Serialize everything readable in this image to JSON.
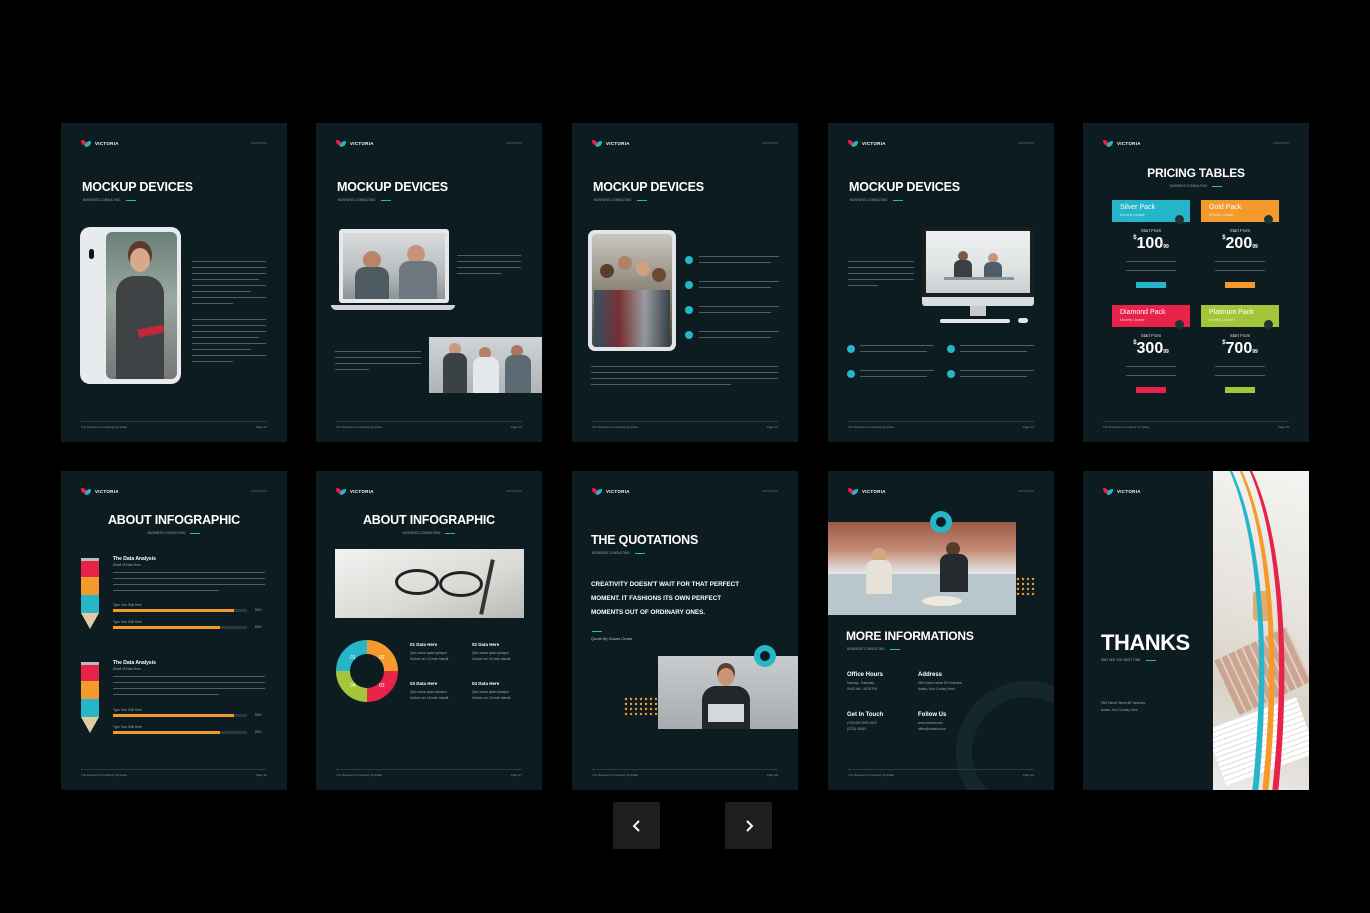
{
  "brand": "VICTORIA",
  "subtitle": "BUSINESS CONSULTING",
  "footer_left": "The Business Consulting Template",
  "accent_colors": {
    "teal": "#25b7c9",
    "pink": "#e8234a",
    "orange": "#f49a2c",
    "lime": "#a4c43a",
    "bg": "#0d1c20"
  },
  "slides": {
    "s1": {
      "title": "MOCKUP DEVICES",
      "page": "Page 21"
    },
    "s2": {
      "title": "MOCKUP DEVICES",
      "page": "Page 22"
    },
    "s3": {
      "title": "MOCKUP DEVICES",
      "page": "Page 23"
    },
    "s4": {
      "title": "MOCKUP DEVICES",
      "page": "Page 24"
    },
    "s5": {
      "title": "PRICING TABLES",
      "page": "Page 25",
      "start_from": "Start From",
      "packs": [
        {
          "name": "Silver Pack",
          "sub": "Monthly Update",
          "currency": "$",
          "price": "100",
          "cents": "99"
        },
        {
          "name": "Gold Pack",
          "sub": "Monthly Update",
          "currency": "$",
          "price": "200",
          "cents": "99"
        },
        {
          "name": "Diamond Pack",
          "sub": "Monthly Update",
          "currency": "$",
          "price": "300",
          "cents": "99"
        },
        {
          "name": "Platinum Pack",
          "sub": "Monthly Update",
          "currency": "$",
          "price": "700",
          "cents": "99"
        }
      ]
    },
    "s6": {
      "title": "ABOUT INFOGRAPHIC",
      "page": "Page 26",
      "heading1": "The Data Analysis",
      "heading2": "The Data Analysis",
      "detail": "Detail Of Data Here",
      "skill_label": "Type Your Skill Here",
      "skills": [
        {
          "pct": "90%",
          "value": 0.9
        },
        {
          "pct": "80%",
          "value": 0.8
        },
        {
          "pct": "90%",
          "value": 0.9
        },
        {
          "pct": "80%",
          "value": 0.8
        }
      ]
    },
    "s7": {
      "title": "ABOUT INFOGRAPHIC",
      "page": "Page 27",
      "items": [
        {
          "label": "01 Data Here",
          "text": "Quis varius quam quisque",
          "text2": "Id diam vel. Ut enim blandit"
        },
        {
          "label": "02 Data Here",
          "text": "Quis varius quam quisque",
          "text2": "Id diam vel. Ut enim blandit"
        },
        {
          "label": "03 Data Here",
          "text": "Quis varius quam quisque",
          "text2": "Id diam vel. Ut enim blandit"
        },
        {
          "label": "04 Data Here",
          "text": "Quis varius quam quisque",
          "text2": "Id diam vel. Ut enim blandit"
        }
      ],
      "ring_labels": [
        "01",
        "02",
        "03",
        "04"
      ]
    },
    "s8": {
      "title": "THE QUOTATIONS",
      "page": "Page 28",
      "quote_l1": "CREATIVITY DOESN'T WAIT FOR THAT PERFECT",
      "quote_l2": "MOMENT. IT FASHIONS ITS OWN PERFECT",
      "quote_l3": "MOMENTS OUT OF ORDINARY ONES.",
      "author": "Quote By Susan Oman"
    },
    "s9": {
      "title": "MORE INFORMATIONS",
      "page": "Page 29",
      "office_hours": "Office Hours",
      "office_l1": "Monday - Saturday",
      "office_l2": "09.00 AM - 08.00 PM",
      "address": "Address",
      "address_l1": "99/4 Dance street 65 Yorkrows,",
      "address_l2": "Austia, Your Country Here",
      "get_in_touch": "Get In Touch",
      "touch_l1": "(+62) 000 0000 0000",
      "touch_l2": "(0721) 00000",
      "follow_us": "Follow Us",
      "follow_l1": "www.victoria.com",
      "follow_l2": "office@victoria.com"
    },
    "s10": {
      "title": "THANKS",
      "tagline": "AND SEE YOU NEXT TIME",
      "addr_l1": "99/4 Dance Street 65 Yorkrows,",
      "addr_l2": "Austia, Your Country Here"
    }
  },
  "nav": {
    "prev": "previous",
    "next": "next"
  }
}
